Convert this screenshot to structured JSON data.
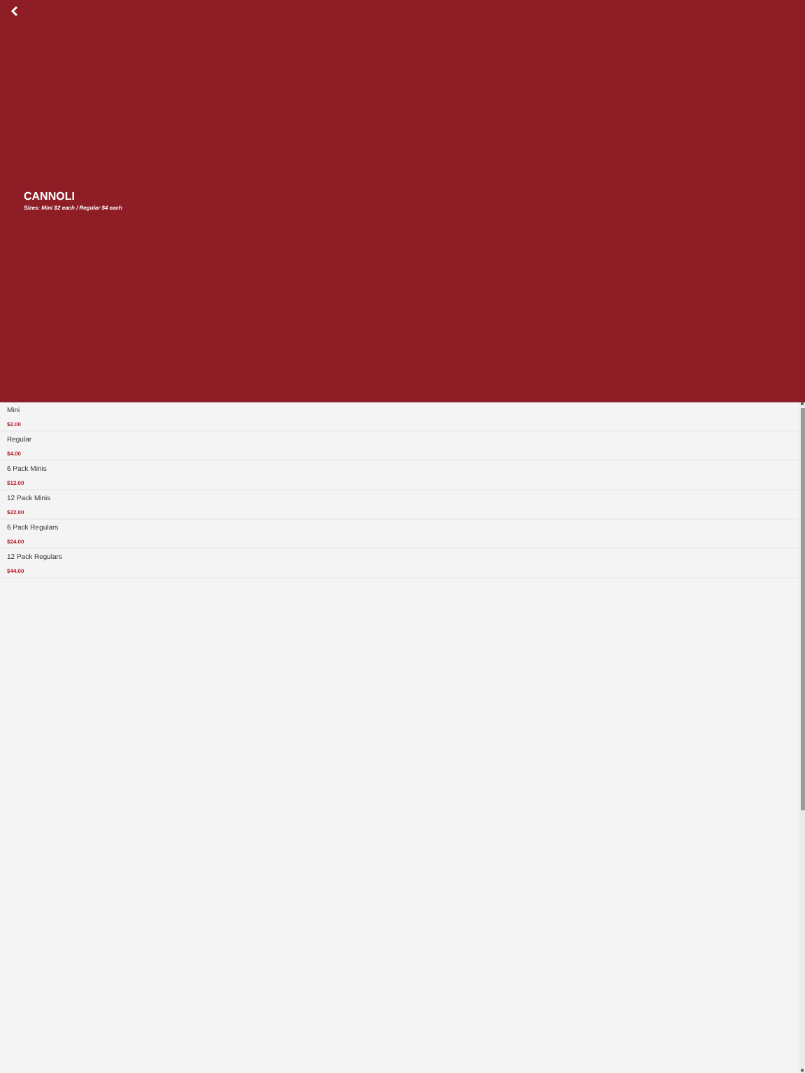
{
  "header": {
    "title": "CANNOLI",
    "subtitle": "Sizes: Mini $2 each / Regular $4 each"
  },
  "items": [
    {
      "name": "Mini",
      "price": "$2.00"
    },
    {
      "name": "Regular",
      "price": "$4.00"
    },
    {
      "name": "6 Pack Minis",
      "price": "$12.00"
    },
    {
      "name": "12 Pack Minis",
      "price": "$22.00"
    },
    {
      "name": "6 Pack Regulars",
      "price": "$24.00"
    },
    {
      "name": "12 Pack Regulars",
      "price": "$44.00"
    }
  ]
}
